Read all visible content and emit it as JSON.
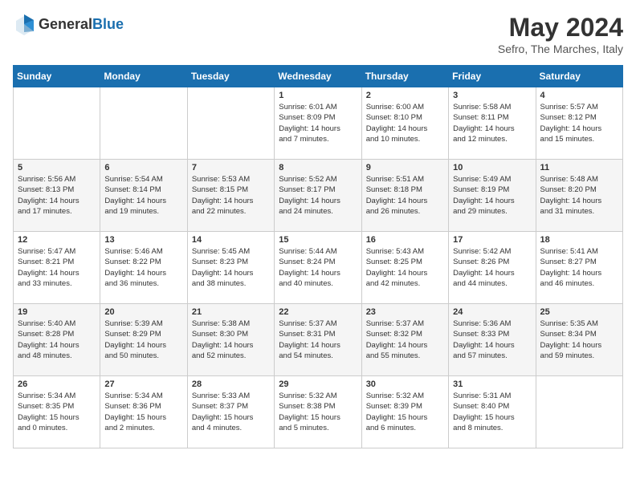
{
  "header": {
    "logo_general": "General",
    "logo_blue": "Blue",
    "title": "May 2024",
    "subtitle": "Sefro, The Marches, Italy"
  },
  "days_of_week": [
    "Sunday",
    "Monday",
    "Tuesday",
    "Wednesday",
    "Thursday",
    "Friday",
    "Saturday"
  ],
  "weeks": [
    [
      {
        "day": "",
        "info": ""
      },
      {
        "day": "",
        "info": ""
      },
      {
        "day": "",
        "info": ""
      },
      {
        "day": "1",
        "info": "Sunrise: 6:01 AM\nSunset: 8:09 PM\nDaylight: 14 hours\nand 7 minutes."
      },
      {
        "day": "2",
        "info": "Sunrise: 6:00 AM\nSunset: 8:10 PM\nDaylight: 14 hours\nand 10 minutes."
      },
      {
        "day": "3",
        "info": "Sunrise: 5:58 AM\nSunset: 8:11 PM\nDaylight: 14 hours\nand 12 minutes."
      },
      {
        "day": "4",
        "info": "Sunrise: 5:57 AM\nSunset: 8:12 PM\nDaylight: 14 hours\nand 15 minutes."
      }
    ],
    [
      {
        "day": "5",
        "info": "Sunrise: 5:56 AM\nSunset: 8:13 PM\nDaylight: 14 hours\nand 17 minutes."
      },
      {
        "day": "6",
        "info": "Sunrise: 5:54 AM\nSunset: 8:14 PM\nDaylight: 14 hours\nand 19 minutes."
      },
      {
        "day": "7",
        "info": "Sunrise: 5:53 AM\nSunset: 8:15 PM\nDaylight: 14 hours\nand 22 minutes."
      },
      {
        "day": "8",
        "info": "Sunrise: 5:52 AM\nSunset: 8:17 PM\nDaylight: 14 hours\nand 24 minutes."
      },
      {
        "day": "9",
        "info": "Sunrise: 5:51 AM\nSunset: 8:18 PM\nDaylight: 14 hours\nand 26 minutes."
      },
      {
        "day": "10",
        "info": "Sunrise: 5:49 AM\nSunset: 8:19 PM\nDaylight: 14 hours\nand 29 minutes."
      },
      {
        "day": "11",
        "info": "Sunrise: 5:48 AM\nSunset: 8:20 PM\nDaylight: 14 hours\nand 31 minutes."
      }
    ],
    [
      {
        "day": "12",
        "info": "Sunrise: 5:47 AM\nSunset: 8:21 PM\nDaylight: 14 hours\nand 33 minutes."
      },
      {
        "day": "13",
        "info": "Sunrise: 5:46 AM\nSunset: 8:22 PM\nDaylight: 14 hours\nand 36 minutes."
      },
      {
        "day": "14",
        "info": "Sunrise: 5:45 AM\nSunset: 8:23 PM\nDaylight: 14 hours\nand 38 minutes."
      },
      {
        "day": "15",
        "info": "Sunrise: 5:44 AM\nSunset: 8:24 PM\nDaylight: 14 hours\nand 40 minutes."
      },
      {
        "day": "16",
        "info": "Sunrise: 5:43 AM\nSunset: 8:25 PM\nDaylight: 14 hours\nand 42 minutes."
      },
      {
        "day": "17",
        "info": "Sunrise: 5:42 AM\nSunset: 8:26 PM\nDaylight: 14 hours\nand 44 minutes."
      },
      {
        "day": "18",
        "info": "Sunrise: 5:41 AM\nSunset: 8:27 PM\nDaylight: 14 hours\nand 46 minutes."
      }
    ],
    [
      {
        "day": "19",
        "info": "Sunrise: 5:40 AM\nSunset: 8:28 PM\nDaylight: 14 hours\nand 48 minutes."
      },
      {
        "day": "20",
        "info": "Sunrise: 5:39 AM\nSunset: 8:29 PM\nDaylight: 14 hours\nand 50 minutes."
      },
      {
        "day": "21",
        "info": "Sunrise: 5:38 AM\nSunset: 8:30 PM\nDaylight: 14 hours\nand 52 minutes."
      },
      {
        "day": "22",
        "info": "Sunrise: 5:37 AM\nSunset: 8:31 PM\nDaylight: 14 hours\nand 54 minutes."
      },
      {
        "day": "23",
        "info": "Sunrise: 5:37 AM\nSunset: 8:32 PM\nDaylight: 14 hours\nand 55 minutes."
      },
      {
        "day": "24",
        "info": "Sunrise: 5:36 AM\nSunset: 8:33 PM\nDaylight: 14 hours\nand 57 minutes."
      },
      {
        "day": "25",
        "info": "Sunrise: 5:35 AM\nSunset: 8:34 PM\nDaylight: 14 hours\nand 59 minutes."
      }
    ],
    [
      {
        "day": "26",
        "info": "Sunrise: 5:34 AM\nSunset: 8:35 PM\nDaylight: 15 hours\nand 0 minutes."
      },
      {
        "day": "27",
        "info": "Sunrise: 5:34 AM\nSunset: 8:36 PM\nDaylight: 15 hours\nand 2 minutes."
      },
      {
        "day": "28",
        "info": "Sunrise: 5:33 AM\nSunset: 8:37 PM\nDaylight: 15 hours\nand 4 minutes."
      },
      {
        "day": "29",
        "info": "Sunrise: 5:32 AM\nSunset: 8:38 PM\nDaylight: 15 hours\nand 5 minutes."
      },
      {
        "day": "30",
        "info": "Sunrise: 5:32 AM\nSunset: 8:39 PM\nDaylight: 15 hours\nand 6 minutes."
      },
      {
        "day": "31",
        "info": "Sunrise: 5:31 AM\nSunset: 8:40 PM\nDaylight: 15 hours\nand 8 minutes."
      },
      {
        "day": "",
        "info": ""
      }
    ]
  ]
}
